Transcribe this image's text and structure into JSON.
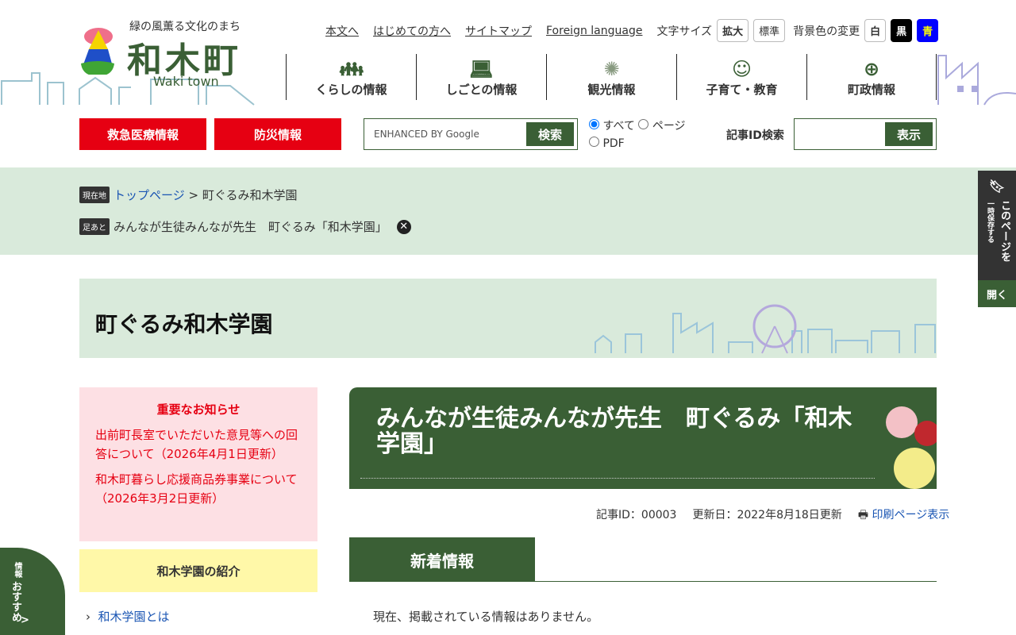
{
  "header": {
    "tagline": "緑の風薫る文化のまち",
    "town_name": "和木町",
    "town_en": "Waki town",
    "util_links": [
      "本文へ",
      "はじめての方へ",
      "サイトマップ",
      "Foreign language"
    ],
    "font_size_label": "文字サイズ",
    "font_larger": "拡大",
    "font_normal": "標準",
    "bg_label": "背景色の変更",
    "bg_white": "白",
    "bg_black": "黒",
    "bg_blue": "青"
  },
  "gnav": [
    {
      "label": "くらしの情報",
      "icon": "family-icon"
    },
    {
      "label": "しごとの情報",
      "icon": "worker-icon"
    },
    {
      "label": "観光情報",
      "icon": "fireworks-icon"
    },
    {
      "label": "子育て・教育",
      "icon": "child-face-icon"
    },
    {
      "label": "町政情報",
      "icon": "town-emblem-icon"
    }
  ],
  "emergency": "救急医療情報",
  "disaster": "防災情報",
  "search": {
    "placeholder": "ENHANCED BY Google",
    "button": "検索",
    "opt_all": "すべて",
    "opt_page": "ページ",
    "opt_pdf": "PDF",
    "id_label": "記事ID検索",
    "id_button": "表示"
  },
  "breadcrumb": {
    "here_tag": "現在地",
    "top": "トップページ",
    "sep": ">",
    "current": "町ぐるみ和木学園",
    "history_tag": "足あと",
    "history_item": "みんなが生徒みんなが先生　町ぐるみ「和木学園」"
  },
  "section_title": "町ぐるみ和木学園",
  "notice": {
    "title": "重要なお知らせ",
    "items": [
      {
        "link": "出前町長室でいただいた意見等への回答について",
        "date": "（2026年4月1日更新）"
      },
      {
        "link": "和木町暮らし応援商品券事業について",
        "date": "（2026年3月2日更新）"
      }
    ]
  },
  "side_menu": {
    "heading": "和木学園の紹介",
    "items": [
      "和木学園とは"
    ]
  },
  "article": {
    "title": "みんなが生徒みんなが先生　町ぐるみ「和木学園」",
    "id": "記事ID：00003",
    "updated": "更新日：2022年8月18日更新",
    "print": "印刷ページ表示",
    "news_heading": "新着情報",
    "no_info": "現在、掲載されている情報はありません。"
  },
  "save_tab": {
    "line1": "このページを",
    "line2": "一時保存する",
    "open": "開く"
  },
  "recommend": {
    "label": "おすすめ",
    "sub": "情報",
    "arrow": ">"
  }
}
